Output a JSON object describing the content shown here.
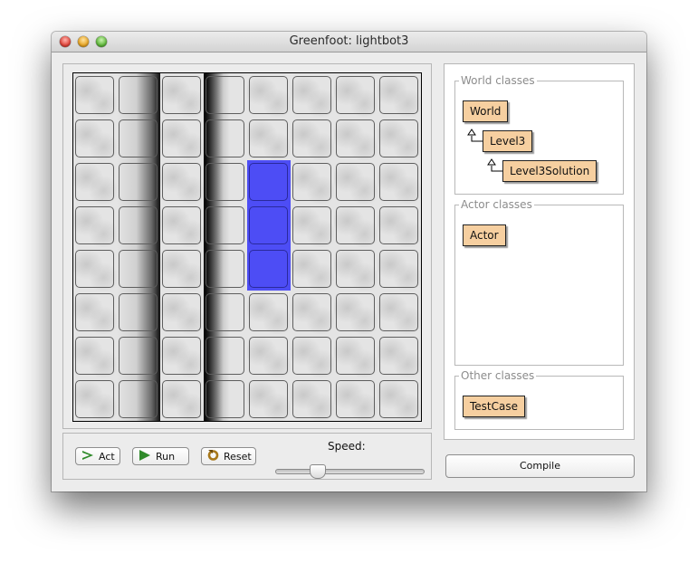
{
  "window": {
    "title": "Greenfoot: lightbot3"
  },
  "world": {
    "columns": 8,
    "rows": 8,
    "lit_cells": [
      [
        2,
        4
      ],
      [
        3,
        4
      ],
      [
        4,
        4
      ]
    ],
    "shade_right_column": 1,
    "shade_left_column": 3,
    "lit_color": "#4d4df5"
  },
  "controls": {
    "act_label": "Act",
    "run_label": "Run",
    "reset_label": "Reset",
    "speed_label": "Speed:",
    "speed_value": 0.26
  },
  "classes": {
    "world_title": "World classes",
    "world_items": [
      "World",
      "Level3",
      "Level3Solution"
    ],
    "actor_title": "Actor classes",
    "actor_items": [
      "Actor"
    ],
    "other_title": "Other classes",
    "other_items": [
      "TestCase"
    ],
    "class_color": "#f6cfa0"
  },
  "compile_label": "Compile"
}
